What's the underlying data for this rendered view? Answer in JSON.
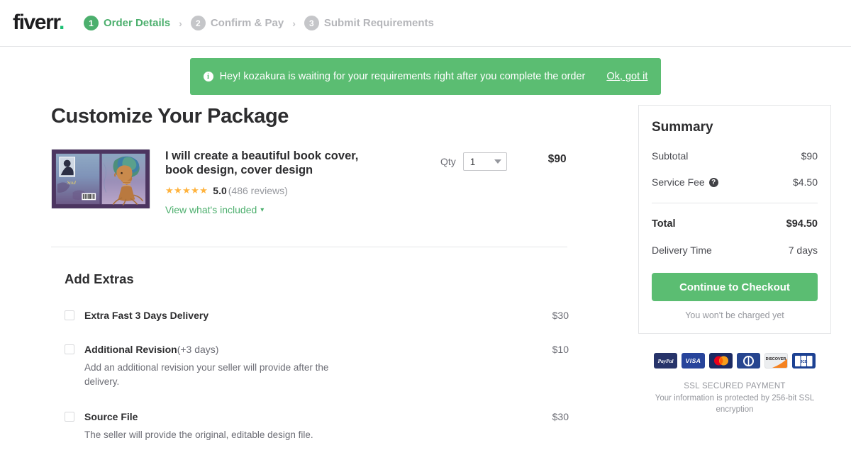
{
  "header": {
    "logo_text": "fiverr",
    "logo_dot": ".",
    "steps": [
      {
        "num": "1",
        "label": "Order Details",
        "state": "active"
      },
      {
        "num": "2",
        "label": "Confirm & Pay",
        "state": "inactive"
      },
      {
        "num": "3",
        "label": "Submit Requirements",
        "state": "inactive"
      }
    ],
    "separator": "›"
  },
  "banner": {
    "icon": "info-icon",
    "icon_glyph": "i",
    "message": "Hey! kozakura is waiting for your requirements right after you complete the order",
    "action_label": "Ok, got it",
    "background": "#5bbd72"
  },
  "main": {
    "page_title": "Customize Your Package",
    "gig": {
      "title": "I will create a beautiful book cover, book design, cover design",
      "stars": "★★★★★",
      "rating": "5.0",
      "reviews": "(486 reviews)",
      "view_included": "View what's included",
      "chevron": "⌄",
      "qty_label": "Qty",
      "qty_value": "1",
      "price": "$90"
    },
    "extras_title": "Add Extras",
    "extras": [
      {
        "name": "Extra Fast 3 Days Delivery",
        "sub": "",
        "price": "$30",
        "description": "",
        "checked": false
      },
      {
        "name": "Additional Revision",
        "sub": " (+3 days)",
        "price": "$10",
        "description": "Add an additional revision your seller will provide after the delivery.",
        "checked": false
      },
      {
        "name": "Source File",
        "sub": "",
        "price": "$30",
        "description": "The seller will provide the original, editable design file.",
        "checked": false
      }
    ]
  },
  "summary": {
    "title": "Summary",
    "rows": [
      {
        "label": "Subtotal",
        "value": "$90",
        "help": false
      },
      {
        "label": "Service Fee",
        "value": "$4.50",
        "help": true
      }
    ],
    "total_label": "Total",
    "total_value": "$94.50",
    "delivery_label": "Delivery Time",
    "delivery_value": "7 days",
    "checkout_label": "Continue to Checkout",
    "charge_note": "You won't be charged yet",
    "help_glyph": "?",
    "accent_color": "#5bbd72"
  },
  "payments": {
    "methods": [
      {
        "name": "paypal-icon",
        "label": "PayPal"
      },
      {
        "name": "visa-icon",
        "label": "VISA"
      },
      {
        "name": "mastercard-icon",
        "label": "MasterCard"
      },
      {
        "name": "diners-club-icon",
        "label": "Diners Club"
      },
      {
        "name": "discover-icon",
        "label": "DISCOVER"
      },
      {
        "name": "jcb-icon",
        "label": "JCB"
      }
    ],
    "ssl_title": "SSL SECURED PAYMENT",
    "ssl_text": "Your information is protected by 256-bit SSL encryption"
  }
}
